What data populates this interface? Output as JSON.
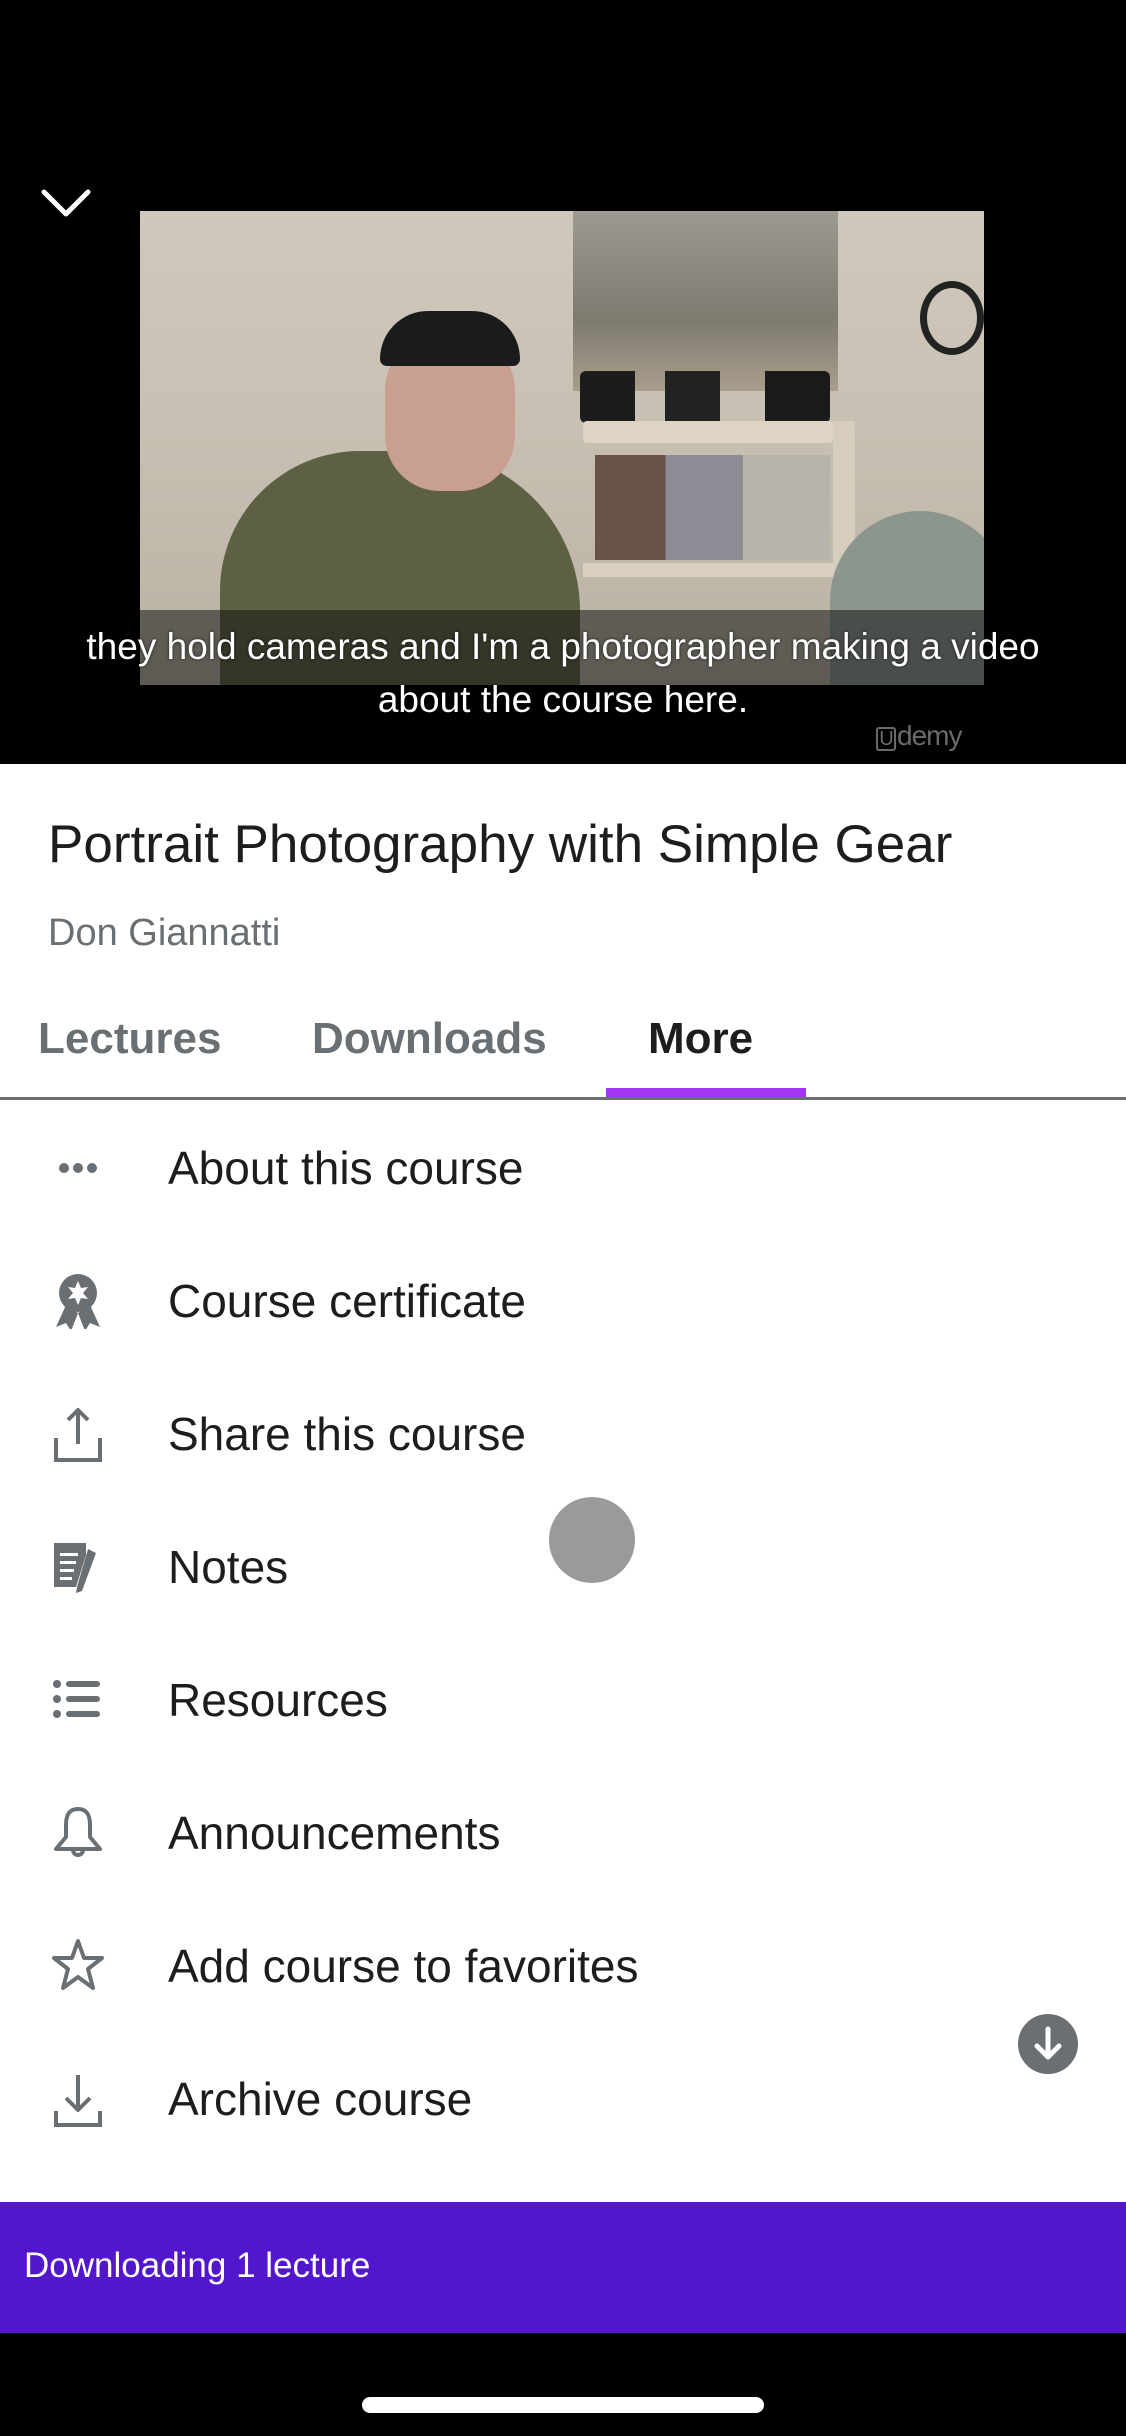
{
  "video": {
    "collapse_icon": "chevron-down-icon",
    "caption": "they hold cameras and I'm a photographer making a video about the course here.",
    "watermark": "demy",
    "watermark_mark": "U"
  },
  "course": {
    "title": "Portrait Photography with Simple Gear",
    "instructor": "Don Giannatti"
  },
  "tabs": {
    "items": [
      {
        "label": "Lectures",
        "active": false
      },
      {
        "label": "Downloads",
        "active": false
      },
      {
        "label": "More",
        "active": true
      }
    ],
    "download_all_icon": "download-circle-icon"
  },
  "menu": {
    "items": [
      {
        "label": "About this course",
        "icon": "more-horizontal-icon"
      },
      {
        "label": "Course certificate",
        "icon": "award-ribbon-icon"
      },
      {
        "label": "Share this course",
        "icon": "share-upload-icon"
      },
      {
        "label": "Notes",
        "icon": "notes-pen-icon"
      },
      {
        "label": "Resources",
        "icon": "list-icon"
      },
      {
        "label": "Announcements",
        "icon": "bell-icon"
      },
      {
        "label": "Add course to favorites",
        "icon": "star-outline-icon"
      },
      {
        "label": "Archive course",
        "icon": "archive-download-icon"
      }
    ]
  },
  "banner": {
    "text": "Downloading 1 lecture"
  },
  "colors": {
    "accent_purple": "#a435f0",
    "banner_purple": "#5217cc",
    "icon_gray": "#6a6f73",
    "text_dark": "#1c1d1f"
  }
}
